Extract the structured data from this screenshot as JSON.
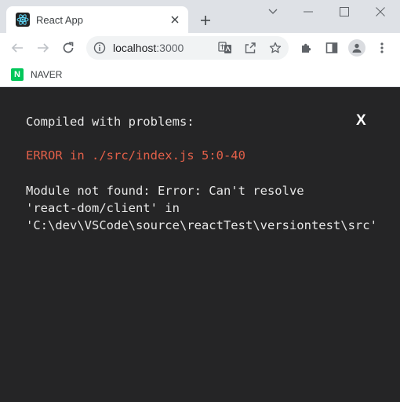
{
  "browser": {
    "tab": {
      "title": "React App"
    },
    "address": {
      "host": "localhost",
      "port": ":3000"
    },
    "bookmarks": [
      {
        "label": "NAVER",
        "logo_letter": "N"
      }
    ],
    "colors": {
      "tab_strip": "#dee1e6",
      "toolbar": "#ffffff",
      "naver_green": "#03c75a"
    }
  },
  "overlay": {
    "title": "Compiled with problems:",
    "close_label": "X",
    "error_header": "ERROR in ./src/index.js 5:0-40",
    "message_lines": [
      "Module not found: Error: Can't resolve",
      "'react-dom/client' in",
      "'C:\\dev\\VSCode\\source\\reactTest\\versiontest\\src'"
    ],
    "colors": {
      "background": "#252526",
      "text": "#e8e8e8",
      "error": "#e36049"
    }
  }
}
